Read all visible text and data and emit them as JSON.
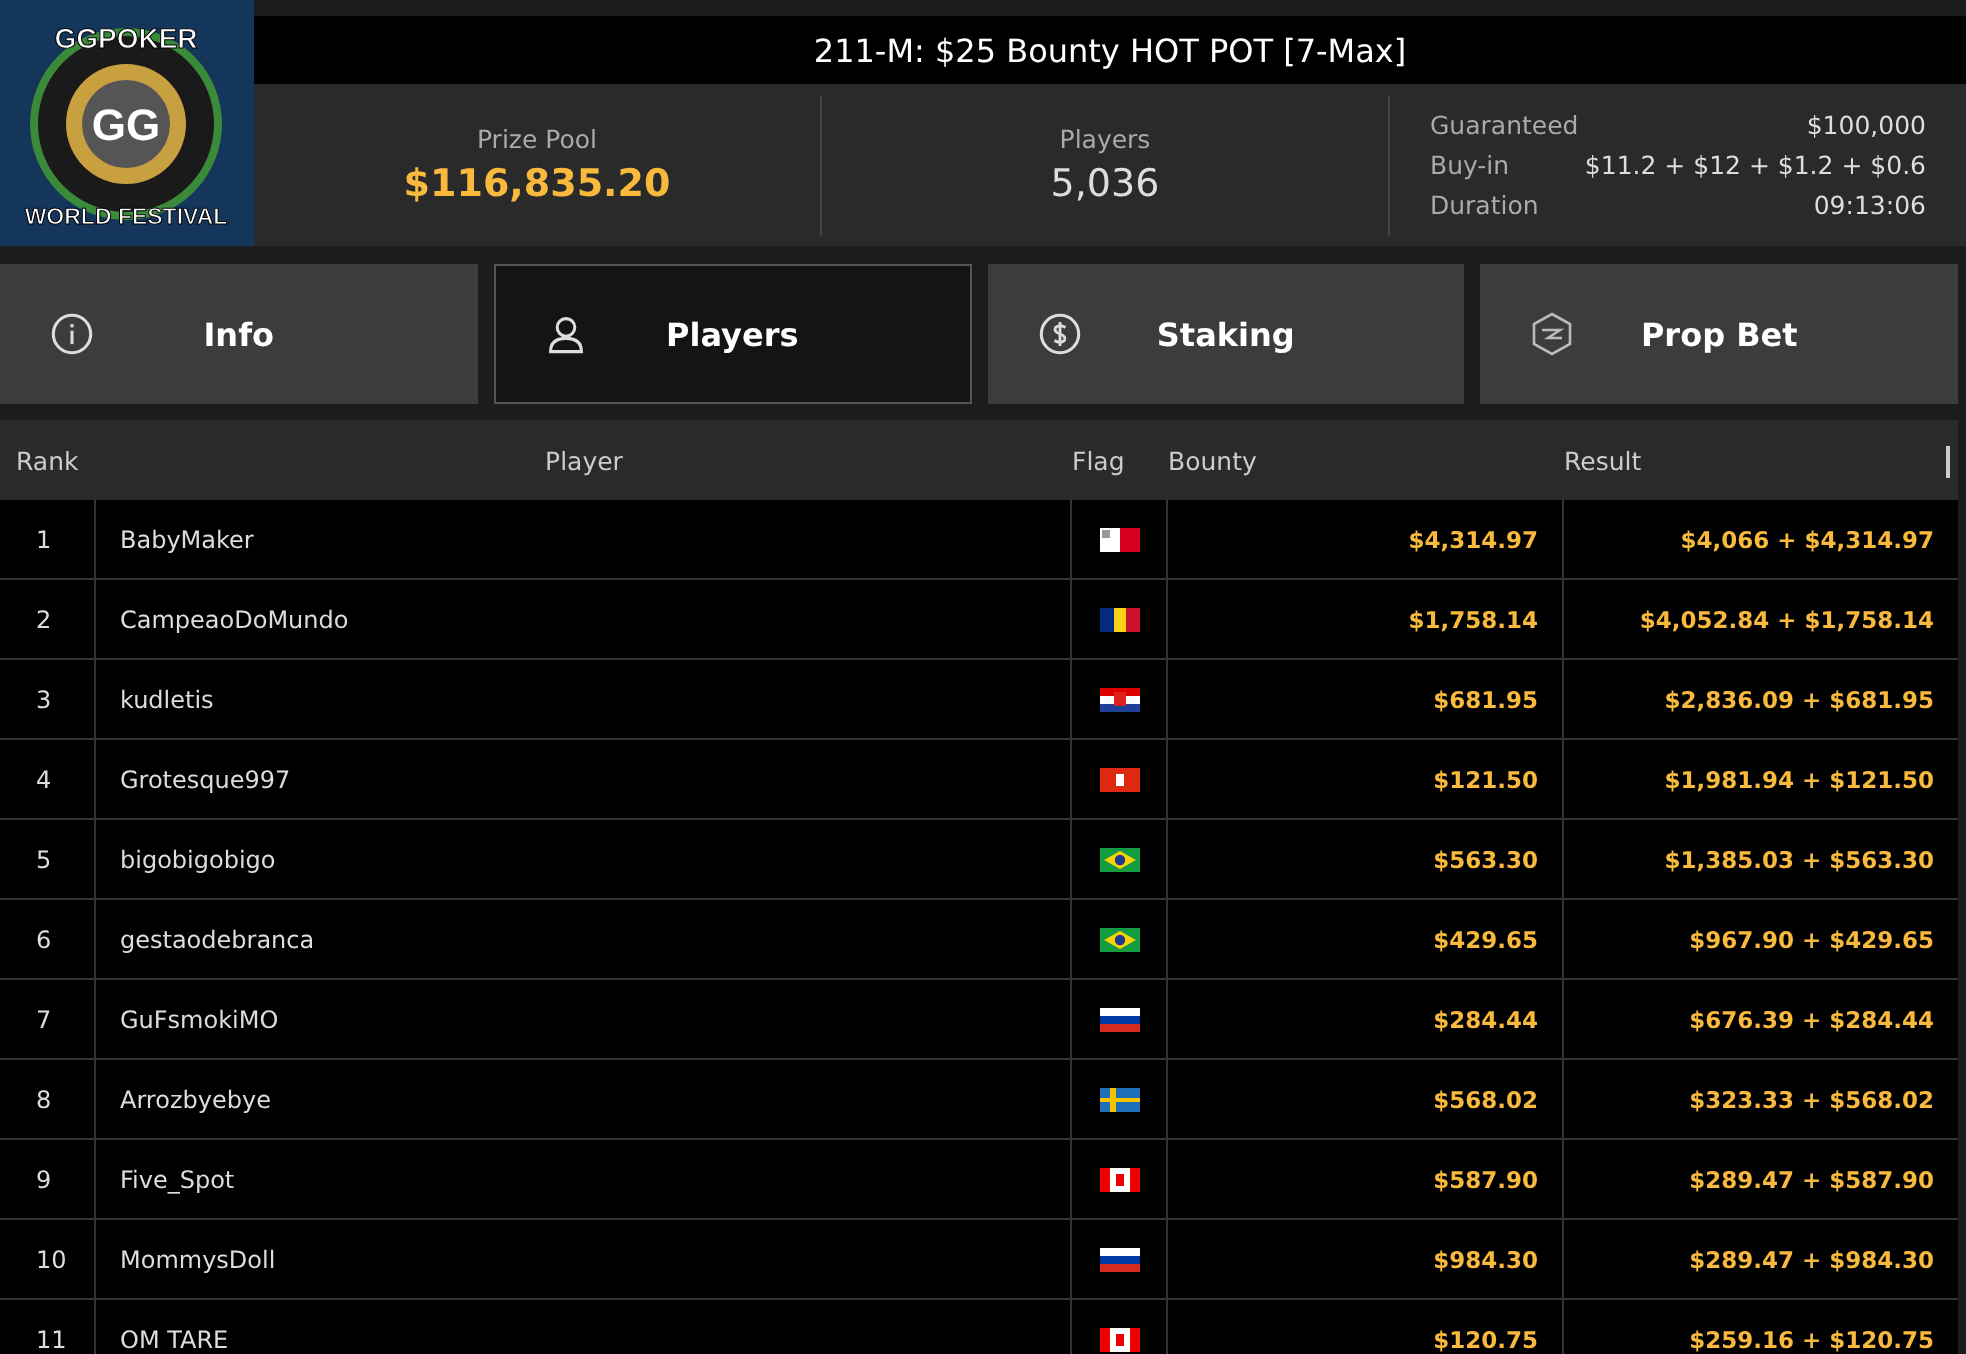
{
  "logo": {
    "top": "GGPOKER",
    "center": "GG",
    "bottom": "WORLD FESTIVAL"
  },
  "title": "211-M: $25 Bounty HOT POT [7-Max]",
  "stats": [
    {
      "label": "Prize Pool",
      "value": "$116,835.20",
      "highlight": true
    },
    {
      "label": "Players",
      "value": "5,036",
      "highlight": false
    }
  ],
  "details": [
    {
      "label": "Guaranteed",
      "value": "$100,000"
    },
    {
      "label": "Buy-in",
      "value": "$11.2 + $12 + $1.2 + $0.6"
    },
    {
      "label": "Duration",
      "value": "09:13:06"
    }
  ],
  "tabs": [
    {
      "label": "Info",
      "kind": "info",
      "selected": false
    },
    {
      "label": "Players",
      "kind": "players",
      "selected": true
    },
    {
      "label": "Staking",
      "kind": "staking",
      "selected": false
    },
    {
      "label": "Prop Bet",
      "kind": "propbet",
      "selected": false
    }
  ],
  "table": {
    "columns": [
      "Rank",
      "Player",
      "Flag",
      "Bounty",
      "Result"
    ],
    "rows": [
      {
        "rank": "1",
        "player": "BabyMaker",
        "kind": "malta",
        "bounty": "$4,314.97",
        "result": "$4,066 + $4,314.97"
      },
      {
        "rank": "2",
        "player": "CampeaoDoMundo",
        "kind": "romania",
        "bounty": "$1,758.14",
        "result": "$4,052.84 + $1,758.14"
      },
      {
        "rank": "3",
        "player": "kudletis",
        "kind": "croatia",
        "bounty": "$681.95",
        "result": "$2,836.09 + $681.95"
      },
      {
        "rank": "4",
        "player": "Grotesque997",
        "kind": "hongkong",
        "bounty": "$121.50",
        "result": "$1,981.94 + $121.50"
      },
      {
        "rank": "5",
        "player": "bigobigobigo",
        "kind": "brazil",
        "bounty": "$563.30",
        "result": "$1,385.03 + $563.30"
      },
      {
        "rank": "6",
        "player": "gestaodebranca",
        "kind": "brazil",
        "bounty": "$429.65",
        "result": "$967.90 + $429.65"
      },
      {
        "rank": "7",
        "player": "GuFsmokiMO",
        "kind": "russia",
        "bounty": "$284.44",
        "result": "$676.39 + $284.44"
      },
      {
        "rank": "8",
        "player": "Arrozbyebye",
        "kind": "sweden",
        "bounty": "$568.02",
        "result": "$323.33 + $568.02"
      },
      {
        "rank": "9",
        "player": "Five_Spot",
        "kind": "canada",
        "bounty": "$587.90",
        "result": "$289.47 + $587.90"
      },
      {
        "rank": "10",
        "player": "MommysDoll",
        "kind": "russia",
        "bounty": "$984.30",
        "result": "$289.47 + $984.30"
      },
      {
        "rank": "11",
        "player": "OM TARE",
        "kind": "canada",
        "bounty": "$120.75",
        "result": "$259.16 + $120.75"
      }
    ]
  }
}
